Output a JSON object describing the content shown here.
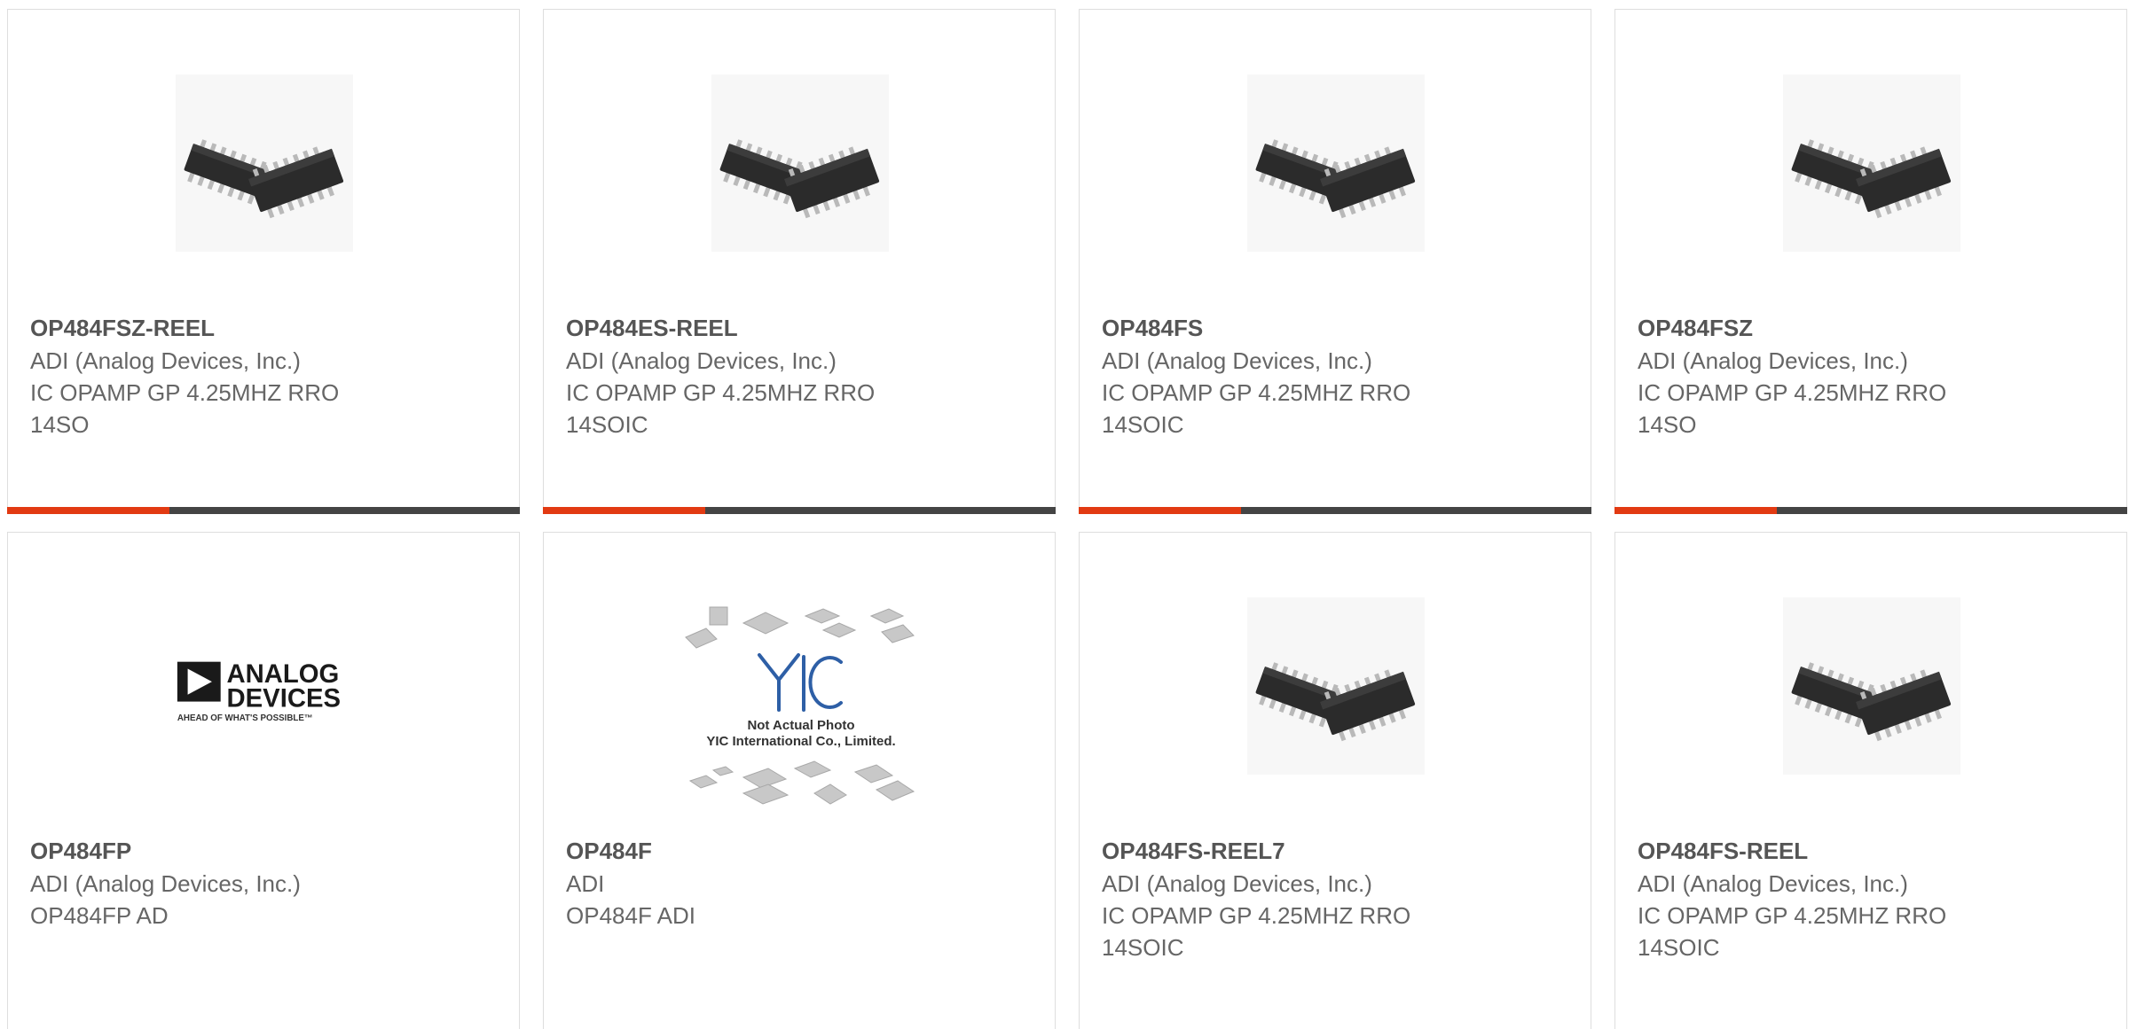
{
  "products": [
    {
      "part": "OP484FSZ-REEL",
      "maker": "ADI (Analog Devices, Inc.)",
      "desc": "IC OPAMP GP 4.25MHZ RRO 14SO",
      "image": "soic-chip-photo"
    },
    {
      "part": "OP484ES-REEL",
      "maker": "ADI (Analog Devices, Inc.)",
      "desc": "IC OPAMP GP 4.25MHZ RRO 14SOIC",
      "image": "soic-chip-photo"
    },
    {
      "part": "OP484FS",
      "maker": "ADI (Analog Devices, Inc.)",
      "desc": "IC OPAMP GP 4.25MHZ RRO 14SOIC",
      "image": "soic-chip-photo"
    },
    {
      "part": "OP484FSZ",
      "maker": "ADI (Analog Devices, Inc.)",
      "desc": "IC OPAMP GP 4.25MHZ RRO 14SO",
      "image": "soic-chip-photo"
    },
    {
      "part": "OP484FP",
      "maker": "ADI (Analog Devices, Inc.)",
      "desc": "OP484FP AD",
      "image": "analog-devices-logo",
      "logo": {
        "line1": "ANALOG",
        "line2": "DEVICES",
        "tagline": "AHEAD OF WHAT'S POSSIBLE™"
      }
    },
    {
      "part": "OP484F",
      "maker": "ADI",
      "desc": "OP484F ADI",
      "image": "yic-placeholder",
      "placeholder": {
        "brand": "YIC",
        "line1": "Not Actual Photo",
        "line2": "YIC International Co., Limited."
      }
    },
    {
      "part": "OP484FS-REEL7",
      "maker": "ADI (Analog Devices, Inc.)",
      "desc": "IC OPAMP GP 4.25MHZ RRO 14SOIC",
      "image": "soic-chip-photo"
    },
    {
      "part": "OP484FS-REEL",
      "maker": "ADI (Analog Devices, Inc.)",
      "desc": "IC OPAMP GP 4.25MHZ RRO 14SOIC",
      "image": "soic-chip-photo"
    }
  ],
  "colors": {
    "accent": "#e23a12",
    "bar": "#444444",
    "text": "#666666",
    "title": "#555555",
    "border": "#dedede"
  }
}
